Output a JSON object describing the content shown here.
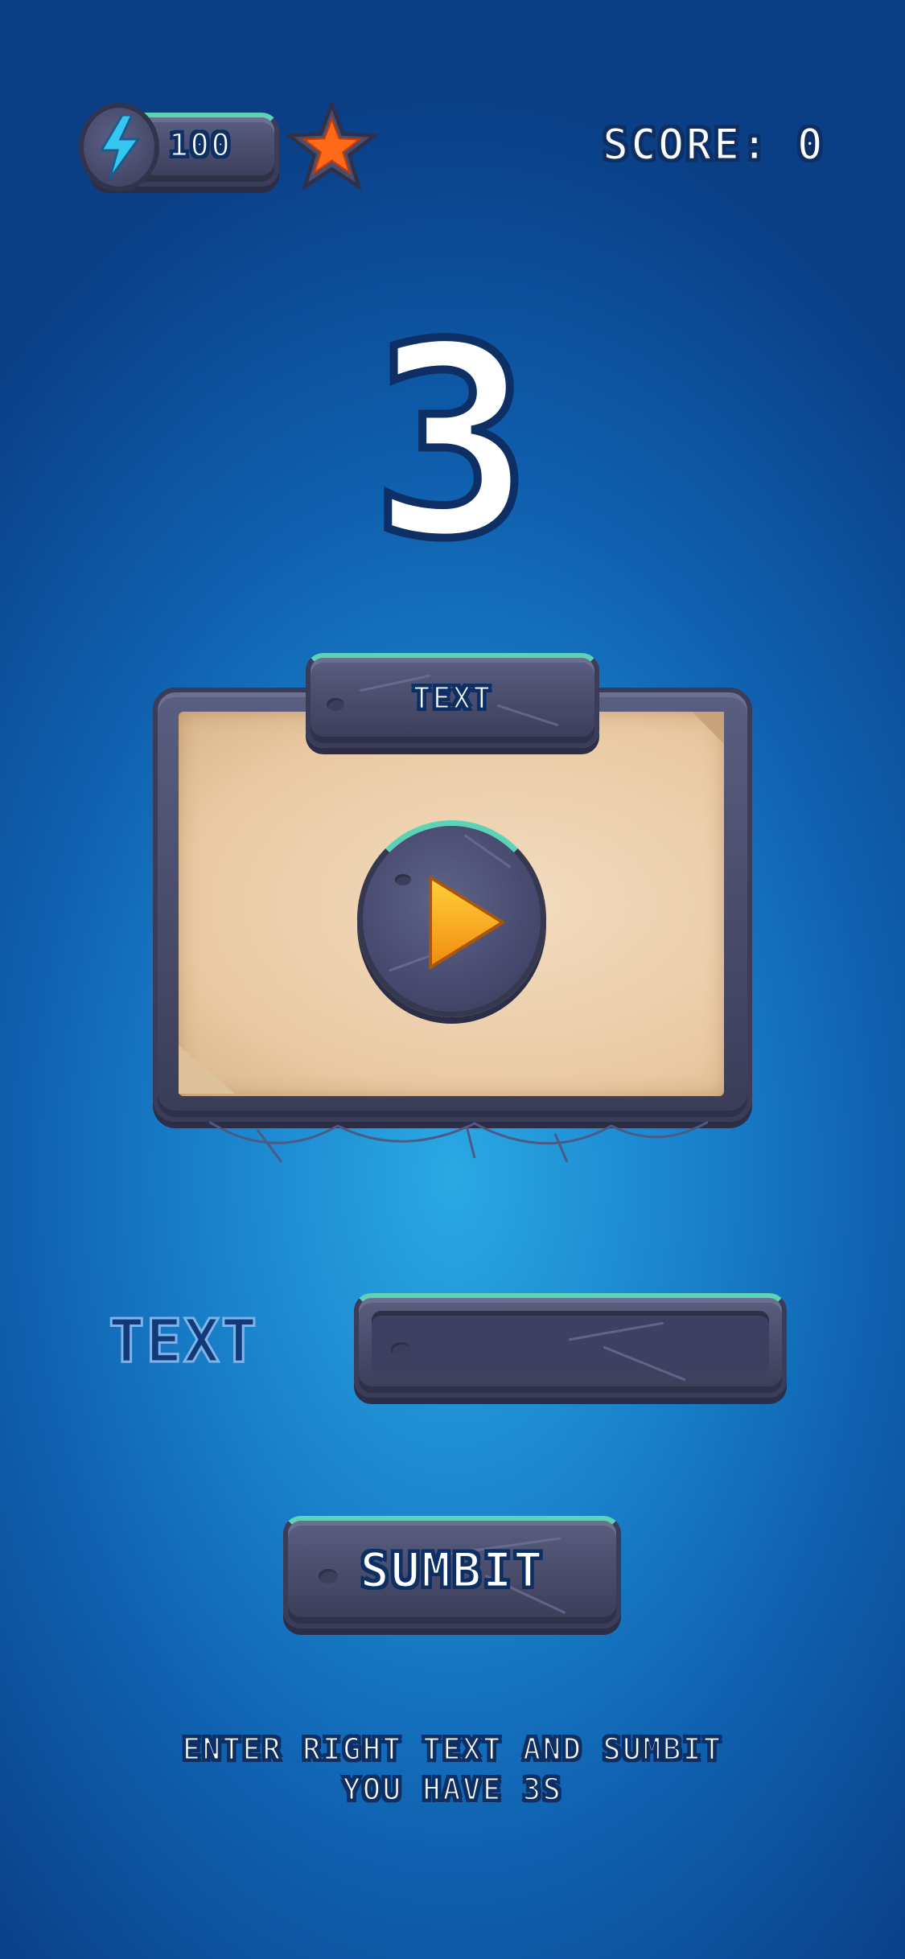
{
  "hud": {
    "energy_value": "100",
    "energy_icon": "lightning-bolt-icon",
    "star_icon": "star-icon",
    "score": "SCORE: 0"
  },
  "countdown": "3",
  "panel": {
    "title": "TEXT",
    "play_icon": "play-icon"
  },
  "input": {
    "label": "TEXT",
    "value": ""
  },
  "submit": {
    "label": "SUMBIT"
  },
  "instructions": {
    "line1": "ENTER RIGHT TEXT AND SUMBIT",
    "line2": "YOU HAVE 3S"
  },
  "colors": {
    "accent": "#5cd3b6",
    "stone": "#484b6a",
    "paper": "#ecd1b0",
    "play": "#f6a21a",
    "energy": "#35c6f2",
    "star": "#ff6a1a"
  }
}
